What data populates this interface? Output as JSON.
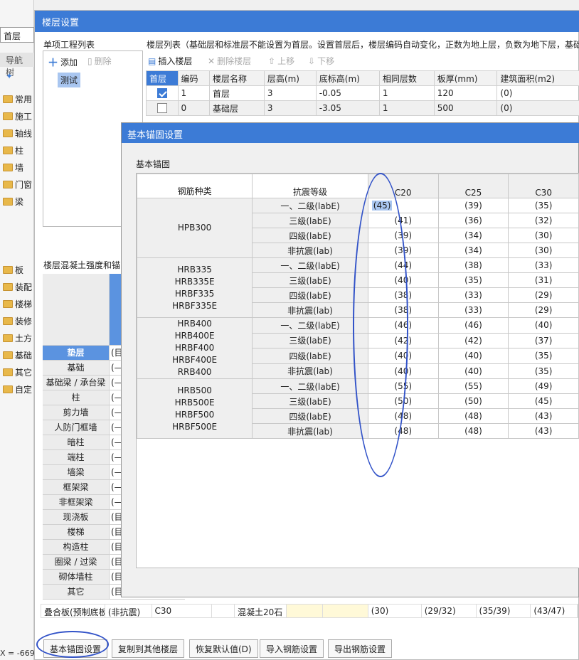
{
  "left": {
    "floor_value": "首层",
    "nav_title": "导航树",
    "nav_items": [
      "常用",
      "施工",
      "轴线",
      "柱",
      "墙",
      "门窗",
      "梁",
      "板",
      "装配",
      "楼梯",
      "装修",
      "土方",
      "基础",
      "其它",
      "自定"
    ],
    "coord_text": "X = -669"
  },
  "dialog1": {
    "title": "楼层设置",
    "project_list_label": "单项工程列表",
    "add_label": "添加",
    "delete_label": "删除",
    "project_item": "测试",
    "floor_list_label": "楼层列表（基础层和标准层不能设置为首层。设置首层后，楼层编码自动变化，正数为地上层，负数为地下层，基础",
    "toolbar": {
      "insert": "插入楼层",
      "delete": "删除楼层",
      "up": "上移",
      "down": "下移"
    },
    "columns": [
      "首层",
      "编码",
      "楼层名称",
      "层高(m)",
      "底标高(m)",
      "相同层数",
      "板厚(mm)",
      "建筑面积(m2)"
    ],
    "rows": [
      {
        "checked": true,
        "code": "1",
        "name": "首层",
        "height": "3",
        "bottom": "-0.05",
        "same": "1",
        "thick": "120",
        "area": "(0)"
      },
      {
        "checked": false,
        "code": "0",
        "name": "基础层",
        "height": "3",
        "bottom": "-3.05",
        "same": "1",
        "thick": "500",
        "area": "(0)"
      }
    ],
    "concrete_label": "楼层混凝土强度和锚",
    "concrete_rows": [
      {
        "name": "垫层",
        "v": "(目"
      },
      {
        "name": "基础",
        "v": "(—"
      },
      {
        "name": "基础梁 / 承台梁",
        "v": "(—"
      },
      {
        "name": "柱",
        "v": "(—"
      },
      {
        "name": "剪力墙",
        "v": "(—"
      },
      {
        "name": "人防门框墙",
        "v": "(—"
      },
      {
        "name": "暗柱",
        "v": "(—"
      },
      {
        "name": "端柱",
        "v": "(—"
      },
      {
        "name": "墙梁",
        "v": "(—"
      },
      {
        "name": "框架梁",
        "v": "(—"
      },
      {
        "name": "非框架梁",
        "v": "(—"
      },
      {
        "name": "现浇板",
        "v": "(目"
      },
      {
        "name": "楼梯",
        "v": "(目"
      },
      {
        "name": "构造柱",
        "v": "(目"
      },
      {
        "name": "圈梁 / 过梁",
        "v": "(目"
      },
      {
        "name": "砌体墙柱",
        "v": "(目"
      },
      {
        "name": "其它",
        "v": "(目"
      }
    ],
    "bottom_row": [
      "叠合板(预制底板)",
      "(非抗震)",
      "C30",
      "",
      "混凝土20石",
      "",
      "",
      "(30)",
      "(29/32)",
      "(35/39)",
      "(43/47)"
    ],
    "buttons": [
      "基本锚固设置",
      "复制到其他楼层",
      "恢复默认值(D)",
      "导入钢筋设置",
      "导出钢筋设置"
    ]
  },
  "dialog2": {
    "title": "基本锚固设置",
    "section_label": "基本锚固",
    "header": {
      "kind": "钢筋种类",
      "level": "抗震等级",
      "grades": [
        "C20",
        "C25",
        "C30"
      ]
    },
    "groups": [
      {
        "kind": [
          "HPB300"
        ],
        "rows": [
          [
            "一、二级(labE)",
            "(45)",
            "(39)",
            "(35)"
          ],
          [
            "三级(labE)",
            "(41)",
            "(36)",
            "(32)"
          ],
          [
            "四级(labE)",
            "(39)",
            "(34)",
            "(30)"
          ],
          [
            "非抗震(lab)",
            "(39)",
            "(34)",
            "(30)"
          ]
        ]
      },
      {
        "kind": [
          "HRB335",
          "HRB335E",
          "HRBF335",
          "HRBF335E"
        ],
        "rows": [
          [
            "一、二级(labE)",
            "(44)",
            "(38)",
            "(33)"
          ],
          [
            "三级(labE)",
            "(40)",
            "(35)",
            "(31)"
          ],
          [
            "四级(labE)",
            "(38)",
            "(33)",
            "(29)"
          ],
          [
            "非抗震(lab)",
            "(38)",
            "(33)",
            "(29)"
          ]
        ]
      },
      {
        "kind": [
          "HRB400",
          "HRB400E",
          "HRBF400",
          "HRBF400E",
          "RRB400"
        ],
        "rows": [
          [
            "一、二级(labE)",
            "(46)",
            "(46)",
            "(40)"
          ],
          [
            "三级(labE)",
            "(42)",
            "(42)",
            "(37)"
          ],
          [
            "四级(labE)",
            "(40)",
            "(40)",
            "(35)"
          ],
          [
            "非抗震(lab)",
            "(40)",
            "(40)",
            "(35)"
          ]
        ]
      },
      {
        "kind": [
          "HRB500",
          "HRB500E",
          "HRBF500",
          "HRBF500E"
        ],
        "rows": [
          [
            "一、二级(labE)",
            "(55)",
            "(55)",
            "(49)"
          ],
          [
            "三级(labE)",
            "(50)",
            "(50)",
            "(45)"
          ],
          [
            "四级(labE)",
            "(48)",
            "(48)",
            "(43)"
          ],
          [
            "非抗震(lab)",
            "(48)",
            "(48)",
            "(43)"
          ]
        ]
      }
    ]
  },
  "colors": {
    "accent": "#3c7bd6",
    "annotation": "#3152c8"
  }
}
